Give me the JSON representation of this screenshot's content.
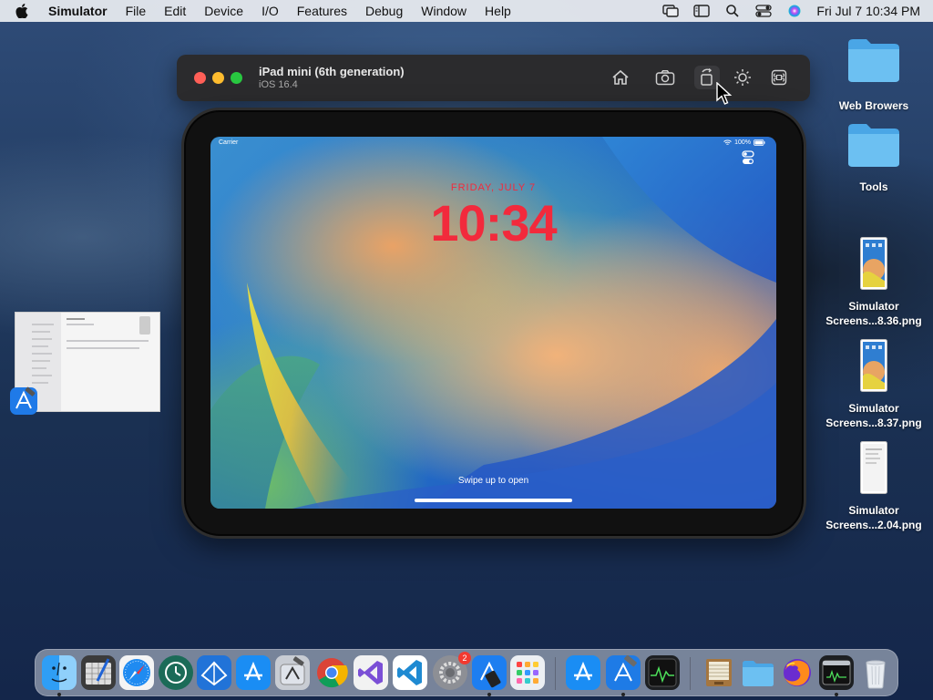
{
  "menubar": {
    "app_name": "Simulator",
    "items": [
      "File",
      "Edit",
      "Device",
      "I/O",
      "Features",
      "Debug",
      "Window",
      "Help"
    ],
    "clock": "Fri Jul 7  10:34 PM"
  },
  "simulator": {
    "device_name": "iPad mini (6th generation)",
    "os_version": "iOS 16.4",
    "toolbar_icons": [
      "home-icon",
      "screenshot-icon",
      "rotate-icon",
      "appearance-icon",
      "keyboard-icon"
    ],
    "screen": {
      "carrier": "Carrier",
      "battery": "100%",
      "date": "FRIDAY, JULY 7",
      "time": "10:34",
      "hint": "Swipe up to open"
    }
  },
  "desktop": {
    "items": [
      {
        "label": "Web Browers"
      },
      {
        "label": "Tools"
      },
      {
        "label_1": "Simulator",
        "label_2": "Screens...8.36.png"
      },
      {
        "label_1": "Simulator",
        "label_2": "Screens...8.37.png"
      },
      {
        "label_1": "Simulator",
        "label_2": "Screens...2.04.png"
      }
    ]
  },
  "dock": {
    "apps": [
      "finder",
      "scripteditor",
      "safari",
      "timemachine",
      "instruments",
      "appstore",
      "xcode-tools",
      "chrome",
      "visualstudio",
      "vscode",
      "systemsettings",
      "simulator",
      "launchpad",
      "appstore-2",
      "xcode",
      "activity-monitor",
      "archive",
      "folder",
      "firefox",
      "console",
      "trash"
    ],
    "settings_badge": "2"
  },
  "colors": {
    "lock_text": "#f22a3c",
    "toolbar_bg": "#2b2b2d"
  }
}
